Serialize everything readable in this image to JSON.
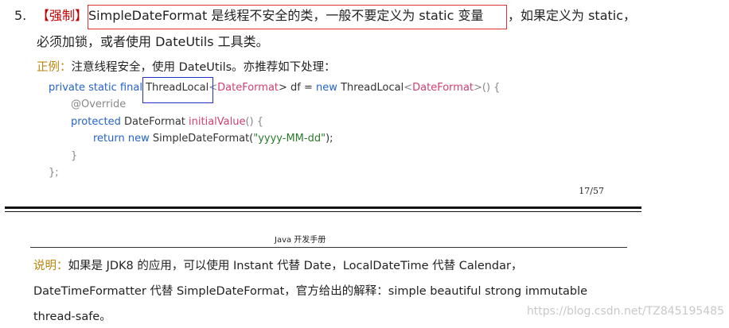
{
  "rule": {
    "number": "5.",
    "tag": "【强制】",
    "text_boxed": "SimpleDateFormat 是线程不安全的类，一般不要定义为 static 变量",
    "text_rest": "，如果定义为 static，",
    "line2": "必须加锁，或者使用 DateUtils 工具类。"
  },
  "example": {
    "label": "正例：",
    "text": "注意线程安全，使用 DateUtils。亦推荐如下处理："
  },
  "code": {
    "l1_kw": "private static final",
    "l1_type": "ThreadLocal",
    "l1_lt": "<",
    "l1_gen": "DateFormat",
    "l1_mid": "> df = ",
    "l1_new": "new",
    "l1_type2": "ThreadLocal",
    "l1_lt2": "<",
    "l1_gen2": "DateFormat",
    "l1_end": ">() {",
    "l2_ann": "@Override",
    "l3_kw": "protected",
    "l3_type": "DateFormat",
    "l3_method": "initialValue",
    "l3_end": "() {",
    "l4_ret": "return",
    "l4_new": "new",
    "l4_cls": "SimpleDateFormat(",
    "l4_str": "\"yyyy-MM-dd\"",
    "l4_end": ");",
    "l5": "}",
    "l6": "};"
  },
  "page_number": "17/57",
  "header_title": "Java 开发手册",
  "note": {
    "label": "说明：",
    "line1": "如果是 JDK8 的应用，可以使用 Instant 代替 Date，LocalDateTime 代替 Calendar，",
    "line2": "DateTimeFormatter 代替 SimpleDateFormat，官方给出的解释：simple beautiful strong immutable",
    "line3": "thread-safe。"
  },
  "watermark": "https://blog.csdn.net/TZ845195485"
}
